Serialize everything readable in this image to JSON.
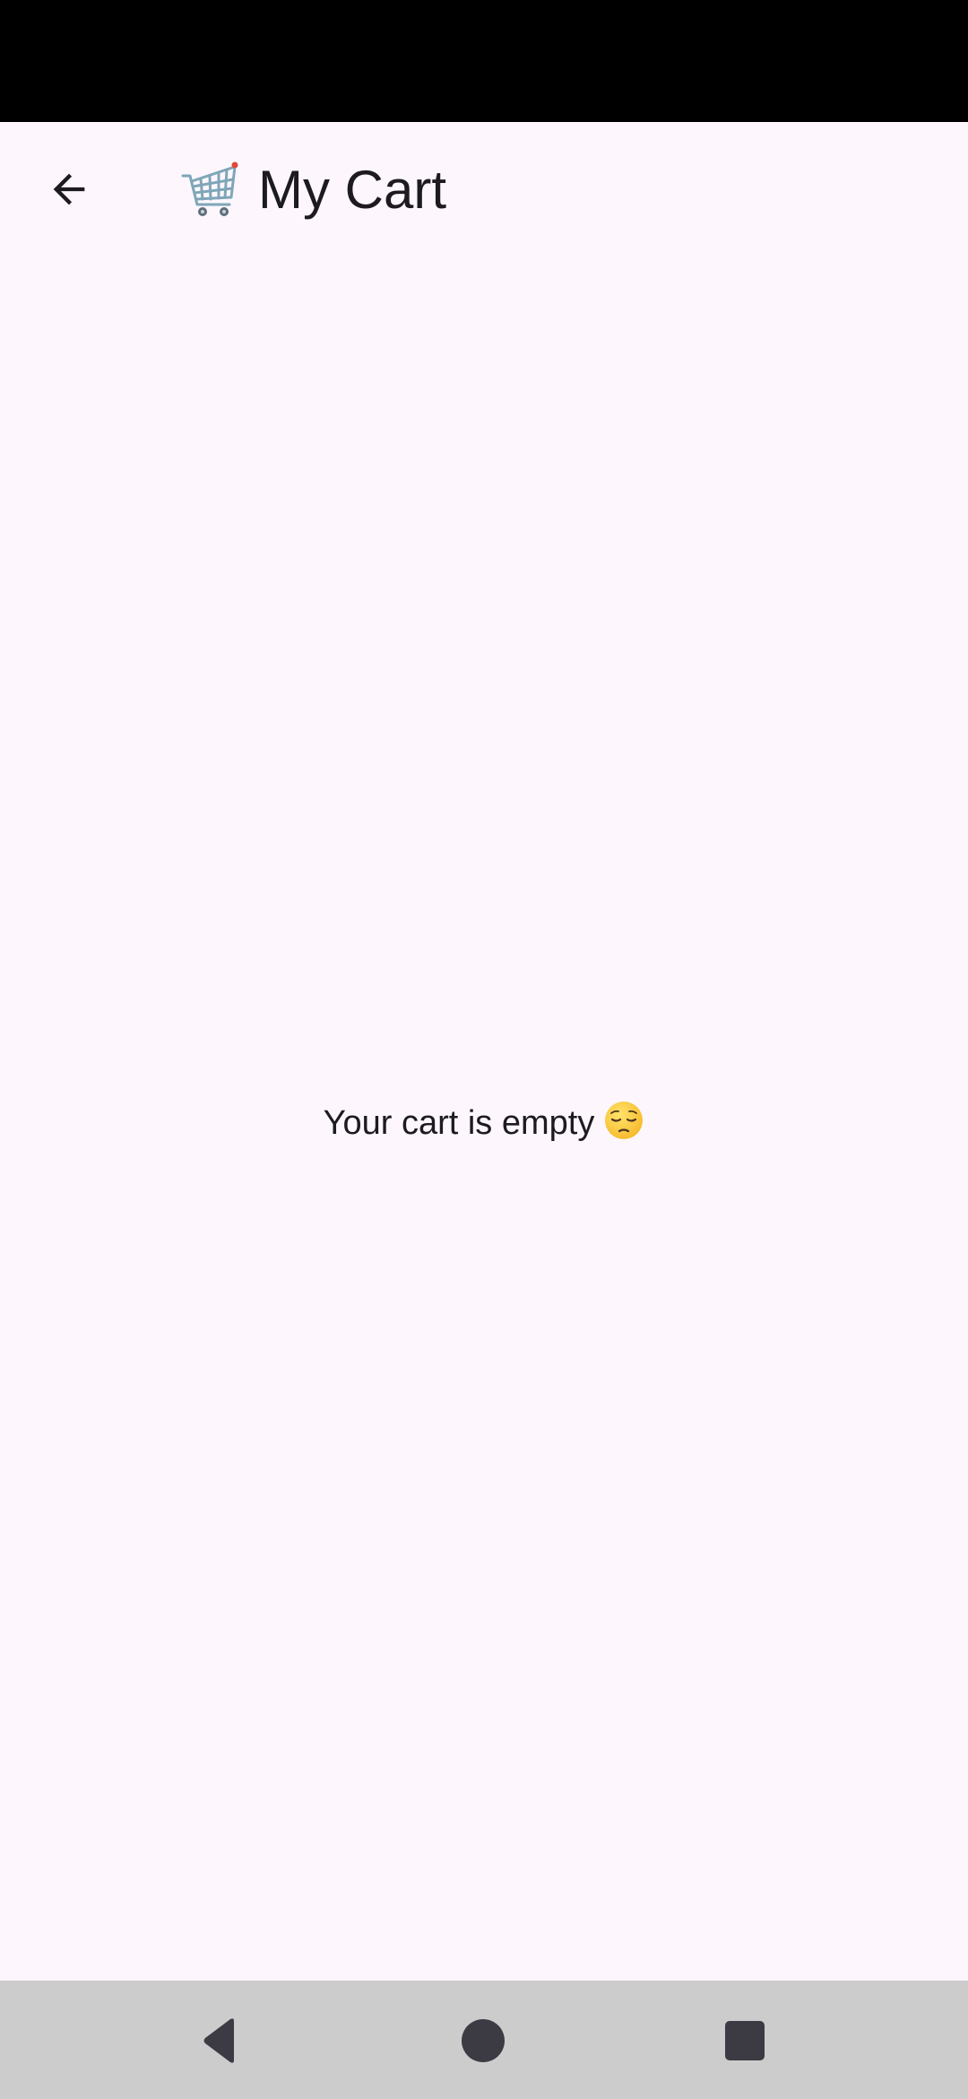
{
  "app_bar": {
    "title": "My Cart",
    "title_icon": "shopping-cart-icon",
    "back_icon": "arrow-back-icon"
  },
  "content": {
    "empty_message": "Your cart is empty",
    "empty_icon": "pensive-face-icon"
  },
  "nav_bar": {
    "back_icon": "nav-back-icon",
    "home_icon": "nav-home-icon",
    "recents_icon": "nav-recents-icon"
  },
  "colors": {
    "background": "#fdf7fd",
    "text": "#1d1b20",
    "status_bar": "#000000",
    "nav_bar": "#cccccc",
    "nav_icon": "#3c3b44"
  }
}
